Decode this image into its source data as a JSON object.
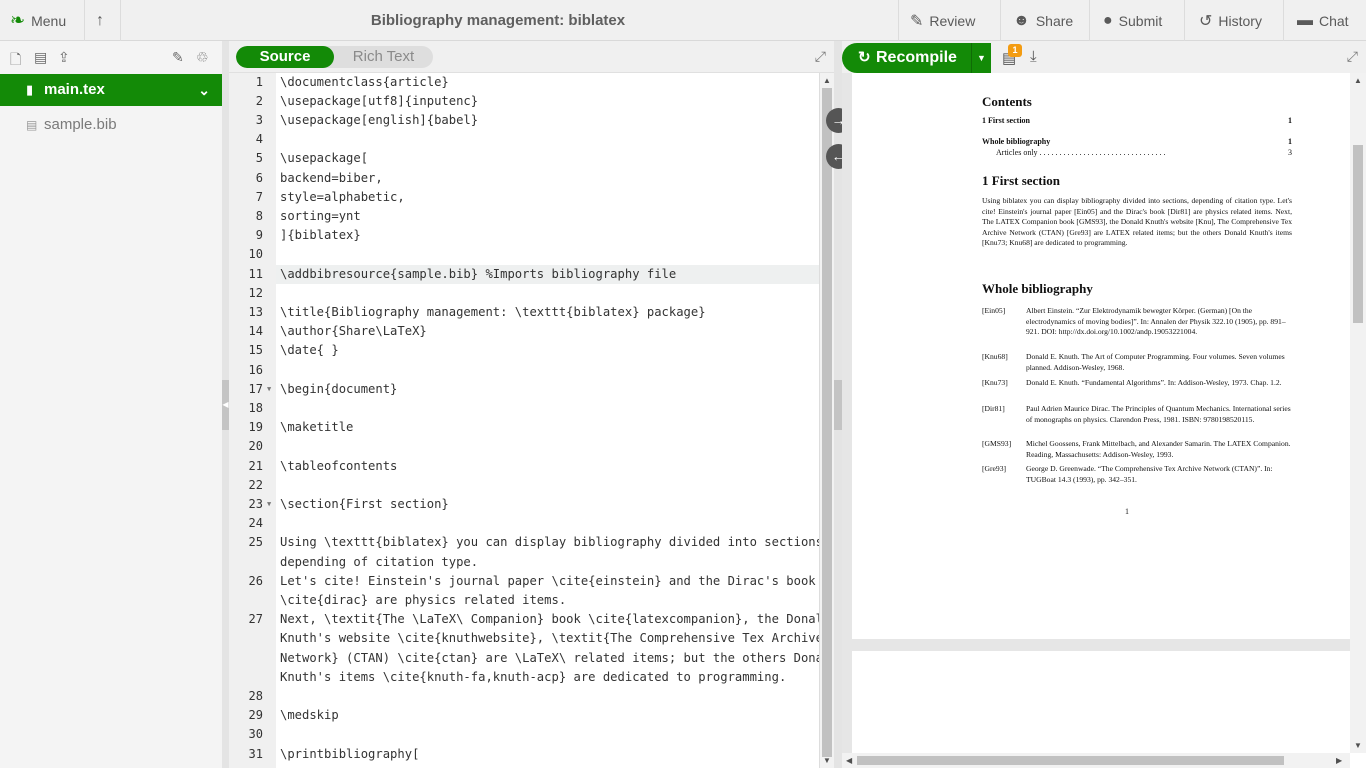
{
  "topbar": {
    "menu": "Menu",
    "title": "Bibliography management: biblatex",
    "review": "Review",
    "share": "Share",
    "submit": "Submit",
    "history": "History",
    "chat": "Chat"
  },
  "sidebar": {
    "files": [
      {
        "name": "main.tex",
        "selected": true
      },
      {
        "name": "sample.bib",
        "selected": false
      }
    ]
  },
  "editor": {
    "mode_source": "Source",
    "mode_rich": "Rich Text",
    "lines": [
      {
        "n": "1",
        "text": "\\documentclass{article}"
      },
      {
        "n": "2",
        "text": "\\usepackage[utf8]{inputenc}"
      },
      {
        "n": "3",
        "text": "\\usepackage[english]{babel}"
      },
      {
        "n": "4",
        "text": ""
      },
      {
        "n": "5",
        "text": "\\usepackage["
      },
      {
        "n": "6",
        "text": "backend=biber,"
      },
      {
        "n": "7",
        "text": "style=alphabetic,"
      },
      {
        "n": "8",
        "text": "sorting=ynt"
      },
      {
        "n": "9",
        "text": "]{biblatex}"
      },
      {
        "n": "10",
        "text": ""
      },
      {
        "n": "11",
        "text": "\\addbibresource{sample.bib} %Imports bibliography file"
      },
      {
        "n": "12",
        "text": ""
      },
      {
        "n": "13",
        "text": "\\title{Bibliography management: \\texttt{biblatex} package}"
      },
      {
        "n": "14",
        "text": "\\author{Share\\LaTeX}"
      },
      {
        "n": "15",
        "text": "\\date{ }"
      },
      {
        "n": "16",
        "text": ""
      },
      {
        "n": "17",
        "text": "\\begin{document}"
      },
      {
        "n": "18",
        "text": ""
      },
      {
        "n": "19",
        "text": "\\maketitle"
      },
      {
        "n": "20",
        "text": ""
      },
      {
        "n": "21",
        "text": "\\tableofcontents"
      },
      {
        "n": "22",
        "text": ""
      },
      {
        "n": "23",
        "text": "\\section{First section}"
      },
      {
        "n": "24",
        "text": ""
      },
      {
        "n": "25",
        "text": "Using \\texttt{biblatex} you can display bibliography divided into sections,"
      },
      {
        "n": "",
        "text": "depending of citation type."
      },
      {
        "n": "26",
        "text": "Let's cite! Einstein's journal paper \\cite{einstein} and the Dirac's book"
      },
      {
        "n": "",
        "text": "\\cite{dirac} are physics related items."
      },
      {
        "n": "27",
        "text": "Next, \\textit{The \\LaTeX\\ Companion} book \\cite{latexcompanion}, the Donald"
      },
      {
        "n": "",
        "text": "Knuth's website \\cite{knuthwebsite}, \\textit{The Comprehensive Tex Archive"
      },
      {
        "n": "",
        "text": "Network} (CTAN) \\cite{ctan} are \\LaTeX\\ related items; but the others Donald"
      },
      {
        "n": "",
        "text": "Knuth's items \\cite{knuth-fa,knuth-acp} are dedicated to programming."
      },
      {
        "n": "28",
        "text": ""
      },
      {
        "n": "29",
        "text": "\\medskip"
      },
      {
        "n": "30",
        "text": ""
      },
      {
        "n": "31",
        "text": "\\printbibliography["
      }
    ]
  },
  "pdf": {
    "recompile": "Recompile",
    "logs_badge": "1",
    "contents_heading": "Contents",
    "toc": [
      {
        "label": "1   First section",
        "page": "1",
        "bold": true
      },
      {
        "label": "Whole bibliography",
        "page": "1",
        "bold": true
      },
      {
        "label": "Articles only  . . . . . . . . . . . . . . . . . . . . . . . . . . . . . . . .",
        "page": "3",
        "bold": false
      }
    ],
    "section1_heading": "1   First section",
    "section1_paragraph": "Using biblatex you can display bibliography divided into sections, depending of citation type. Let's cite! Einstein's journal paper [Ein05] and the Dirac's book [Dir81] are physics related items. Next, The LATEX Companion book [GMS93], the Donald Knuth's website [Knu], The Comprehensive Tex Archive Network (CTAN) [Gre93] are LATEX related items; but the others Donald Knuth's items [Knu73; Knu68] are dedicated to programming.",
    "bib_heading": "Whole bibliography",
    "bibliography": [
      {
        "key": "[Ein05]",
        "text": "Albert Einstein. “Zur Elektrodynamik bewegter Körper. (German) [On the electrodynamics of moving bodies]”. In: Annalen der Physik 322.10 (1905), pp. 891–921. DOI: http://dx.doi.org/10.1002/andp.19053221004."
      },
      {
        "key": "[Knu68]",
        "text": "Donald E. Knuth. The Art of Computer Programming. Four volumes. Seven volumes planned. Addison-Wesley, 1968."
      },
      {
        "key": "[Knu73]",
        "text": "Donald E. Knuth. “Fundamental Algorithms”. In: Addison-Wesley, 1973. Chap. 1.2."
      },
      {
        "key": "[Dir81]",
        "text": "Paul Adrien Maurice Dirac. The Principles of Quantum Mechanics. International series of monographs on physics. Clarendon Press, 1981. ISBN: 9780198520115."
      },
      {
        "key": "[GMS93]",
        "text": "Michel Goossens, Frank Mittelbach, and Alexander Samarin. The LATEX Companion. Reading, Massachusetts: Addison-Wesley, 1993."
      },
      {
        "key": "[Gre93]",
        "text": "George D. Greenwade. “The Comprehensive Tex Archive Network (CTAN)”. In: TUGBoat 14.3 (1993), pp. 342–351."
      }
    ],
    "page_number": "1"
  }
}
